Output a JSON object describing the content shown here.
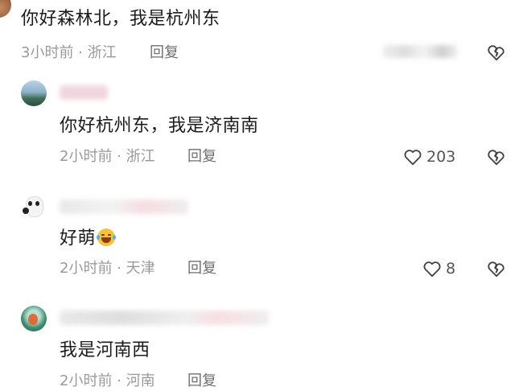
{
  "comments": [
    {
      "text": "你好森林北，我是杭州东",
      "time": "3小时前",
      "location": "浙江",
      "reply_label": "回复"
    },
    {
      "text": "你好杭州东，我是济南南",
      "time": "2小时前",
      "location": "浙江",
      "reply_label": "回复",
      "likes": "203"
    },
    {
      "text": "好萌",
      "emoji": "laughing-tears-emoji",
      "time": "2小时前",
      "location": "天津",
      "reply_label": "回复",
      "likes": "8"
    },
    {
      "text": "我是河南西",
      "time": "2小时前",
      "location": "河南",
      "reply_label": "回复"
    }
  ],
  "separator": "·",
  "icons": [
    "heart-icon",
    "broken-heart-icon",
    "avatar"
  ],
  "colors": {
    "meta": "#9a9a9a",
    "text": "#1c1c1c",
    "icon": "#444444"
  }
}
